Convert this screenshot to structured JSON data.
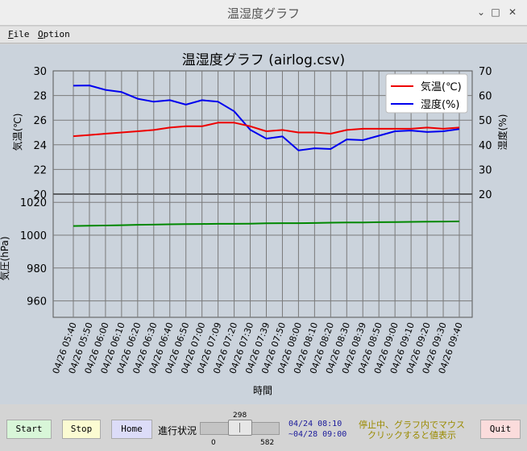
{
  "window": {
    "title": "温湿度グラフ",
    "minimize": "⌄",
    "maximize": "□",
    "close": "✕"
  },
  "menu": [
    {
      "accel": "F",
      "rest": "ile"
    },
    {
      "accel": "O",
      "rest": "ption"
    }
  ],
  "chart_data": {
    "type": "line",
    "title": "温湿度グラフ (airlog.csv)",
    "xlabel": "時間",
    "x": [
      "04/26 05:40",
      "04/26 05:50",
      "04/26 06:00",
      "04/26 06:10",
      "04/26 06:20",
      "04/26 06:30",
      "04/26 06:40",
      "04/26 06:50",
      "04/26 07:00",
      "04/26 07:09",
      "04/26 07:20",
      "04/26 07:30",
      "04/26 07:39",
      "04/26 07:50",
      "04/26 08:00",
      "04/26 08:10",
      "04/26 08:20",
      "04/26 08:30",
      "04/26 08:39",
      "04/26 08:50",
      "04/26 09:00",
      "04/26 09:10",
      "04/26 09:20",
      "04/26 09:30",
      "04/26 09:40"
    ],
    "top_panel": {
      "ylabel_left": "気温(℃)",
      "ylabel_right": "湿度(%)",
      "ylim_left": [
        20,
        30
      ],
      "yticks_left": [
        20,
        22,
        24,
        26,
        28,
        30
      ],
      "ylim_right": [
        20,
        70
      ],
      "yticks_right": [
        20,
        30,
        40,
        50,
        60,
        70
      ],
      "legend_position": "top-right",
      "series": [
        {
          "name": "気温(℃)",
          "axis": "left",
          "color": "#ee0000",
          "values": [
            24.7,
            24.8,
            24.9,
            25.0,
            25.1,
            25.2,
            25.4,
            25.5,
            25.5,
            25.8,
            25.8,
            25.5,
            25.1,
            25.2,
            25.0,
            25.0,
            24.9,
            25.2,
            25.3,
            25.3,
            25.3,
            25.3,
            25.4,
            25.3,
            25.4
          ]
        },
        {
          "name": "湿度(%)",
          "axis": "right",
          "color": "#0000ee",
          "values": [
            64.0,
            64.1,
            62.3,
            61.4,
            58.7,
            57.5,
            58.1,
            56.3,
            58.1,
            57.5,
            53.6,
            46.1,
            42.5,
            43.4,
            37.7,
            38.6,
            38.3,
            42.2,
            41.9,
            43.7,
            45.5,
            45.8,
            45.2,
            45.5,
            46.4
          ]
        }
      ]
    },
    "bottom_panel": {
      "ylabel_left": "気圧(hPa)",
      "ylim": [
        950,
        1025
      ],
      "yticks": [
        960,
        980,
        1000,
        1020
      ],
      "series": [
        {
          "name": "気圧",
          "color": "#008800",
          "values": [
            1005.6,
            1005.8,
            1005.9,
            1006.1,
            1006.3,
            1006.4,
            1006.6,
            1006.7,
            1006.8,
            1006.9,
            1006.9,
            1007.0,
            1007.2,
            1007.3,
            1007.3,
            1007.4,
            1007.6,
            1007.7,
            1007.7,
            1007.9,
            1008.0,
            1008.1,
            1008.2,
            1008.3,
            1008.4
          ]
        }
      ]
    }
  },
  "controls": {
    "start": "Start",
    "stop": "Stop",
    "home": "Home",
    "quit": "Quit",
    "progress_label": "進行状況",
    "slider_value": "298",
    "slider_min": "0",
    "slider_max": "582",
    "slider_fraction": 0.51,
    "range_start": "04/24 08:10",
    "range_end": "~04/28 09:00",
    "status_line1": "停止中、グラフ内でマウス",
    "status_line2": "クリックすると値表示"
  },
  "colors": {
    "plot_bg": "#cbd3dc",
    "start_bg": "#d8f6d8",
    "stop_bg": "#fbfbd2",
    "home_bg": "#dcdcf8",
    "quit_bg": "#fbdcdc"
  }
}
